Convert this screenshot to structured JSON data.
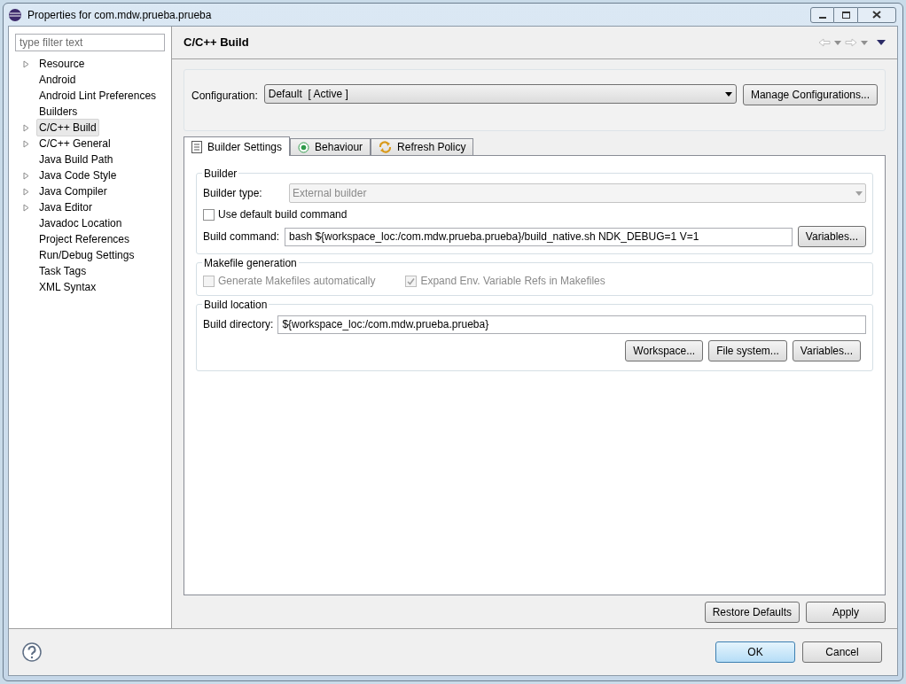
{
  "window": {
    "title": "Properties for com.mdw.prueba.prueba"
  },
  "filter": {
    "placeholder": "type filter text"
  },
  "tree": [
    {
      "label": "Resource",
      "expandable": true,
      "selected": false
    },
    {
      "label": "Android",
      "expandable": false,
      "selected": false
    },
    {
      "label": "Android Lint Preferences",
      "expandable": false,
      "selected": false
    },
    {
      "label": "Builders",
      "expandable": false,
      "selected": false
    },
    {
      "label": "C/C++ Build",
      "expandable": true,
      "selected": true
    },
    {
      "label": "C/C++ General",
      "expandable": true,
      "selected": false
    },
    {
      "label": "Java Build Path",
      "expandable": false,
      "selected": false
    },
    {
      "label": "Java Code Style",
      "expandable": true,
      "selected": false
    },
    {
      "label": "Java Compiler",
      "expandable": true,
      "selected": false
    },
    {
      "label": "Java Editor",
      "expandable": true,
      "selected": false
    },
    {
      "label": "Javadoc Location",
      "expandable": false,
      "selected": false
    },
    {
      "label": "Project References",
      "expandable": false,
      "selected": false
    },
    {
      "label": "Run/Debug Settings",
      "expandable": false,
      "selected": false
    },
    {
      "label": "Task Tags",
      "expandable": false,
      "selected": false
    },
    {
      "label": "XML Syntax",
      "expandable": false,
      "selected": false
    }
  ],
  "page": {
    "title": "C/C++ Build"
  },
  "configuration": {
    "label": "Configuration:",
    "value": "Default  [ Active ]",
    "button": "Manage Configurations..."
  },
  "tabs": [
    {
      "label": "Builder Settings",
      "kind": "list",
      "selected": true
    },
    {
      "label": "Behaviour",
      "kind": "radio",
      "selected": false
    },
    {
      "label": "Refresh Policy",
      "kind": "refresh",
      "selected": false
    }
  ],
  "builder": {
    "title": "Builder",
    "type_label": "Builder type:",
    "type_value": "External builder",
    "use_default": {
      "label": "Use default build command",
      "checked": false,
      "disabled": false
    },
    "command_label": "Build command:",
    "command_value": "bash ${workspace_loc:/com.mdw.prueba.prueba}/build_native.sh NDK_DEBUG=1 V=1",
    "variables_button": "Variables..."
  },
  "makefile": {
    "title": "Makefile generation",
    "options": [
      {
        "label": "Generate Makefiles automatically",
        "checked": false,
        "disabled": true
      },
      {
        "label": "Expand Env. Variable Refs in Makefiles",
        "checked": true,
        "disabled": true
      }
    ]
  },
  "location": {
    "title": "Build location",
    "directory_label": "Build directory:",
    "directory_value": "${workspace_loc:/com.mdw.prueba.prueba}",
    "buttons": [
      "Workspace...",
      "File system...",
      "Variables..."
    ]
  },
  "page_buttons": [
    "Restore Defaults",
    "Apply"
  ],
  "dialog_buttons": [
    {
      "label": "OK",
      "default": true
    },
    {
      "label": "Cancel",
      "default": false
    }
  ]
}
